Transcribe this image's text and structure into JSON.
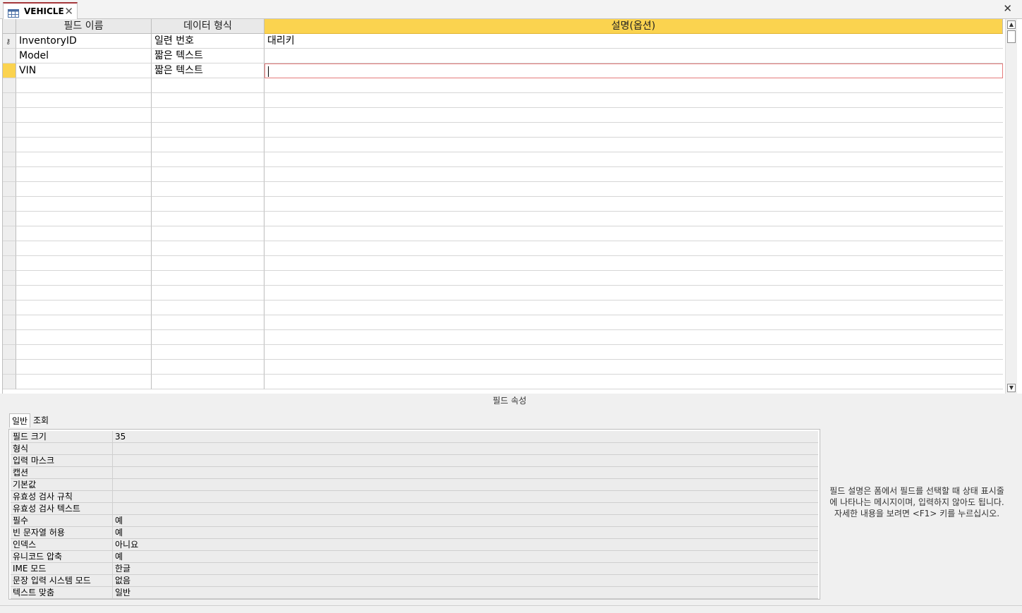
{
  "tab": {
    "title": "VEHICLE"
  },
  "grid": {
    "headers": [
      "필드 이름",
      "데이터 형식",
      "설명(옵션)"
    ],
    "rows": [
      {
        "name": "InventoryID",
        "type": "일련 번호",
        "desc": "대리키"
      },
      {
        "name": "Model",
        "type": "짧은 텍스트",
        "desc": ""
      },
      {
        "name": "VIN",
        "type": "짧은 텍스트",
        "desc": ""
      }
    ]
  },
  "properties": {
    "caption": "필드 속성",
    "tabs": [
      "일반",
      "조회"
    ],
    "rows": [
      {
        "label": "필드 크기",
        "value": "35"
      },
      {
        "label": "형식",
        "value": ""
      },
      {
        "label": "입력 마스크",
        "value": ""
      },
      {
        "label": "캡션",
        "value": ""
      },
      {
        "label": "기본값",
        "value": ""
      },
      {
        "label": "유효성 검사 규칙",
        "value": ""
      },
      {
        "label": "유효성 검사 텍스트",
        "value": ""
      },
      {
        "label": "필수",
        "value": "예"
      },
      {
        "label": "빈 문자열 허용",
        "value": "예"
      },
      {
        "label": "인덱스",
        "value": "아니요"
      },
      {
        "label": "유니코드 압축",
        "value": "예"
      },
      {
        "label": "IME 모드",
        "value": "한글"
      },
      {
        "label": "문장 입력 시스템 모드",
        "value": "없음"
      },
      {
        "label": "텍스트 맞춤",
        "value": "일반"
      }
    ],
    "help": "필드 설명은 폼에서 필드를 선택할 때 상태 표시줄에 나타나는 메시지이며, 입력하지 않아도 됩니다. 자세한 내용을 보려면 <F1> 키를 누르십시오."
  },
  "colors": {
    "accent": "#fbd34f",
    "tab_accent": "#a4373a"
  }
}
